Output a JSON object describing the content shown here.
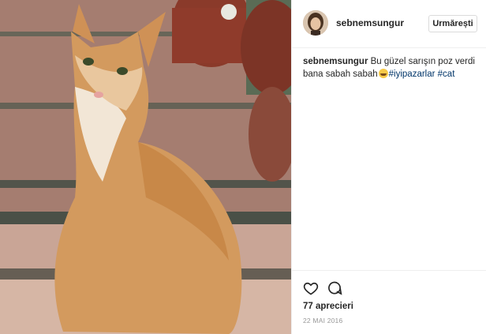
{
  "post": {
    "image_alt": "Orange and white cat sitting on a tiled floor, looking back over its shoulder",
    "author": {
      "username": "sebnemsungur",
      "follow_label": "Urmărești"
    },
    "caption": {
      "username": "sebnemsungur",
      "text": "Bu güzel sarışın poz verdi bana sabah sabah",
      "emoji": "grinning-face-emoji",
      "hashtags": [
        "#iyipazarlar",
        "#cat"
      ]
    },
    "actions": {
      "like_icon": "heart-icon",
      "comment_icon": "comment-icon"
    },
    "likes_text": "77 aprecieri",
    "date": "22 MAI 2016"
  },
  "colors": {
    "text": "#262626",
    "hashtag": "#003569",
    "muted": "#999999",
    "border": "#efefef"
  }
}
